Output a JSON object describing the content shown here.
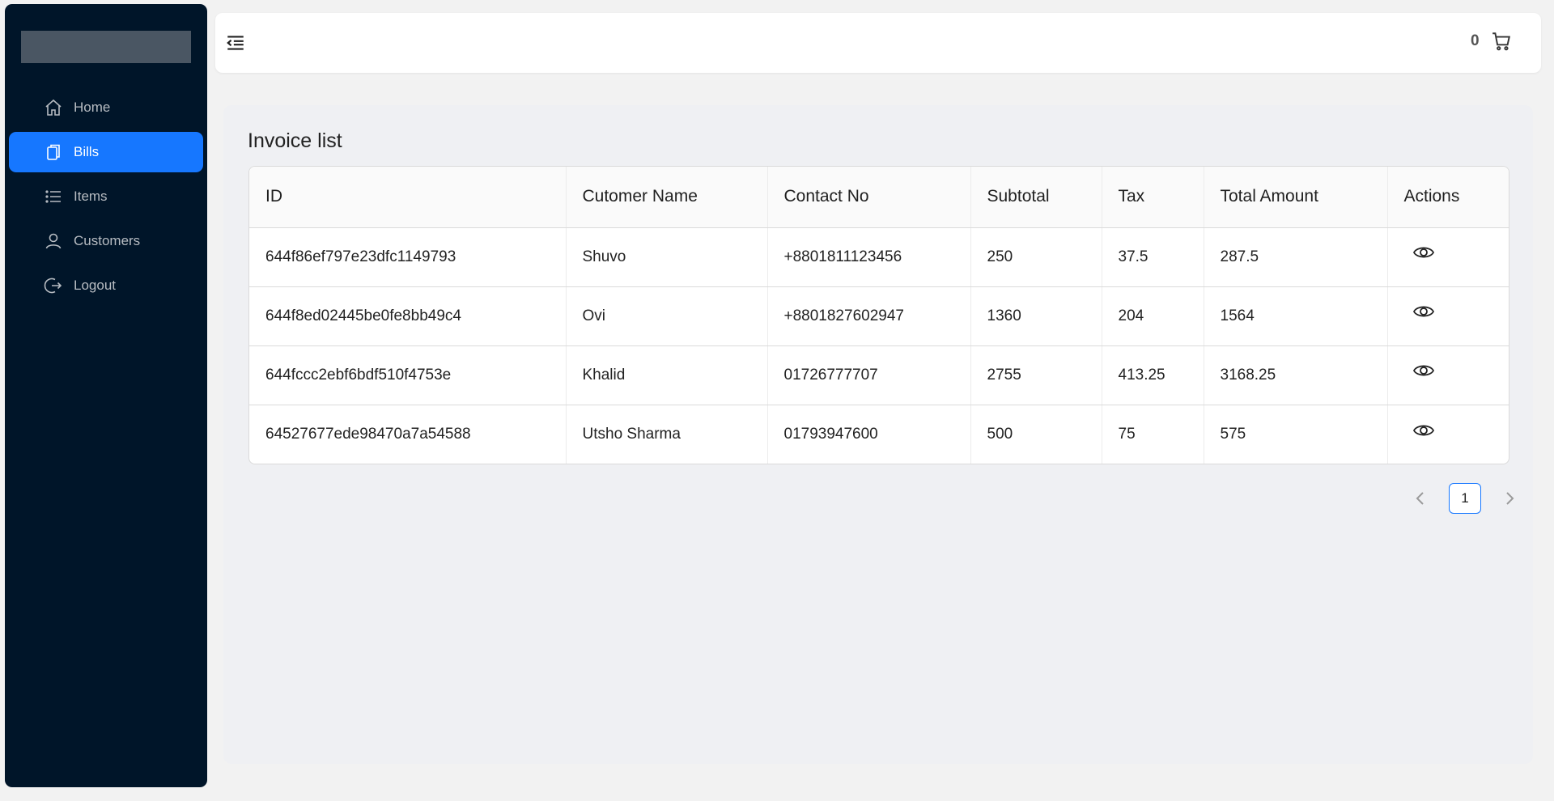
{
  "sidebar": {
    "items": [
      {
        "label": "Home",
        "icon": "home-icon",
        "active": false
      },
      {
        "label": "Bills",
        "icon": "copy-icon",
        "active": true
      },
      {
        "label": "Items",
        "icon": "list-icon",
        "active": false
      },
      {
        "label": "Customers",
        "icon": "user-icon",
        "active": false
      },
      {
        "label": "Logout",
        "icon": "logout-icon",
        "active": false
      }
    ]
  },
  "header": {
    "cart_count": "0",
    "menu_toggle_icon": "menu-fold-icon",
    "cart_icon": "shopping-cart-icon"
  },
  "main": {
    "title": "Invoice list",
    "table": {
      "columns": [
        "ID",
        "Cutomer Name",
        "Contact No",
        "Subtotal",
        "Tax",
        "Total Amount",
        "Actions"
      ],
      "rows": [
        {
          "id": "644f86ef797e23dfc1149793",
          "customer": "Shuvo",
          "contact": "+8801811123456",
          "subtotal": "250",
          "tax": "37.5",
          "total": "287.5"
        },
        {
          "id": "644f8ed02445be0fe8bb49c4",
          "customer": "Ovi",
          "contact": "+8801827602947",
          "subtotal": "1360",
          "tax": "204",
          "total": "1564"
        },
        {
          "id": "644fccc2ebf6bdf510f4753e",
          "customer": "Khalid",
          "contact": "01726777707",
          "subtotal": "2755",
          "tax": "413.25",
          "total": "3168.25"
        },
        {
          "id": "64527677ede98470a7a54588",
          "customer": "Utsho Sharma",
          "contact": "01793947600",
          "subtotal": "500",
          "tax": "75",
          "total": "575"
        }
      ]
    },
    "pagination": {
      "current_page": "1"
    }
  },
  "colors": {
    "sidebar_bg": "#001529",
    "accent": "#1677ff",
    "content_bg": "#eff0f3"
  }
}
